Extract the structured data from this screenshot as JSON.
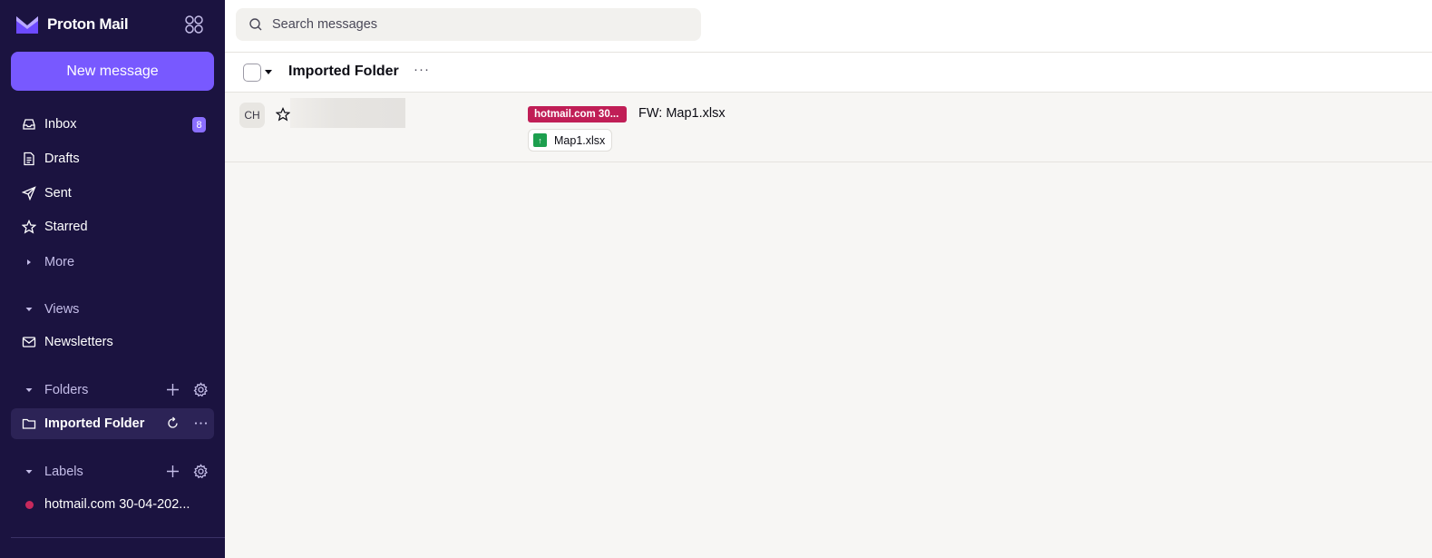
{
  "brand": {
    "name": "Proton Mail"
  },
  "actions": {
    "new_message": "New message"
  },
  "search": {
    "placeholder": "Search messages",
    "value": ""
  },
  "nav": {
    "inbox": {
      "label": "Inbox",
      "count": "8"
    },
    "drafts": "Drafts",
    "sent": "Sent",
    "starred": "Starred",
    "more": "More"
  },
  "sections": {
    "views": "Views",
    "newsletters": "Newsletters",
    "folders": "Folders",
    "labels": "Labels"
  },
  "folders": [
    {
      "name": "Imported Folder"
    }
  ],
  "labels": [
    {
      "name": "hotmail.com 30-04-202...",
      "color": "#c7295c"
    }
  ],
  "toolbar": {
    "title": "Imported Folder",
    "more": "···"
  },
  "messages": [
    {
      "initials": "CH",
      "label": "hotmail.com 30...",
      "subject": "FW: Map1.xlsx",
      "attachment": "Map1.xlsx"
    }
  ],
  "colors": {
    "sidebar": "#1b1340",
    "accent": "#7859ff",
    "label": "#c01e56",
    "excel": "#1d9f4e"
  }
}
